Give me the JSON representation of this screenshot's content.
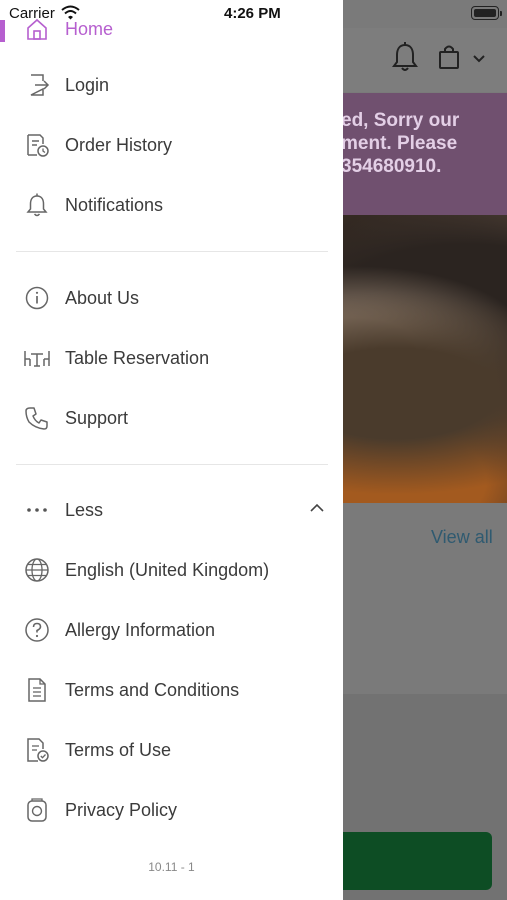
{
  "status_bar": {
    "carrier": "Carrier",
    "time": "4:26 PM"
  },
  "drawer": {
    "items_top": [
      {
        "label": "Home",
        "icon": "home-icon",
        "active": true
      },
      {
        "label": "Login",
        "icon": "login-icon"
      },
      {
        "label": "Order History",
        "icon": "order-history-icon"
      },
      {
        "label": "Notifications",
        "icon": "bell-icon"
      }
    ],
    "items_middle": [
      {
        "label": "About Us",
        "icon": "info-icon"
      },
      {
        "label": "Table Reservation",
        "icon": "table-icon"
      },
      {
        "label": "Support",
        "icon": "phone-icon"
      }
    ],
    "items_bottom": [
      {
        "label": "Less",
        "icon": "more-dots-icon"
      },
      {
        "label": "English (United Kingdom)",
        "icon": "globe-icon"
      },
      {
        "label": "Allergy Information",
        "icon": "question-icon"
      },
      {
        "label": "Terms and Conditions",
        "icon": "document-icon"
      },
      {
        "label": "Terms of Use",
        "icon": "document-check-icon"
      },
      {
        "label": "Privacy Policy",
        "icon": "privacy-icon"
      }
    ],
    "version": "10.11 - 1",
    "accent_color": "#b65fcf"
  },
  "background": {
    "banner_lines": [
      "ed, Sorry our",
      "ment. Please",
      "354680910."
    ],
    "view_all": "View all"
  }
}
